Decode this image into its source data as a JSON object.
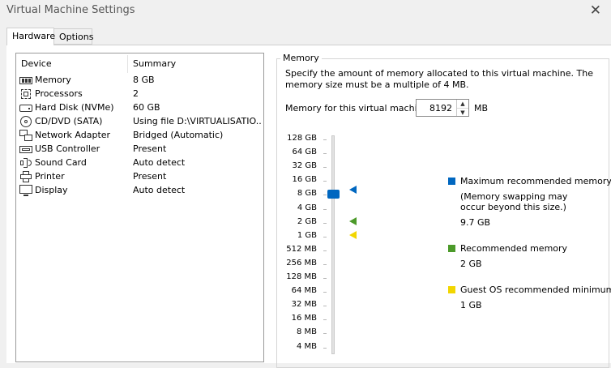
{
  "window": {
    "title": "Virtual Machine Settings",
    "close_glyph": "✕"
  },
  "tabs": [
    {
      "label": "Hardware"
    },
    {
      "label": "Options"
    }
  ],
  "device_list": {
    "headers": {
      "device": "Device",
      "summary": "Summary"
    },
    "rows": [
      {
        "device": "Memory",
        "summary": "8 GB",
        "icon": "memory-icon"
      },
      {
        "device": "Processors",
        "summary": "2",
        "icon": "processor-icon"
      },
      {
        "device": "Hard Disk (NVMe)",
        "summary": "60 GB",
        "icon": "hard-disk-icon"
      },
      {
        "device": "CD/DVD (SATA)",
        "summary": "Using file D:\\VIRTUALISATIO...",
        "icon": "cd-dvd-icon"
      },
      {
        "device": "Network Adapter",
        "summary": "Bridged (Automatic)",
        "icon": "network-adapter-icon"
      },
      {
        "device": "USB Controller",
        "summary": "Present",
        "icon": "usb-icon"
      },
      {
        "device": "Sound Card",
        "summary": "Auto detect",
        "icon": "speaker-icon"
      },
      {
        "device": "Printer",
        "summary": "Present",
        "icon": "printer-icon"
      },
      {
        "device": "Display",
        "summary": "Auto detect",
        "icon": "monitor-icon"
      }
    ]
  },
  "memory": {
    "group_title": "Memory",
    "description": "Specify the amount of memory allocated to this virtual machine. The memory size must be a multiple of 4 MB.",
    "field_label": "Memory for this virtual machine:",
    "value": "8192",
    "unit": "MB",
    "spin_up_glyph": "▲",
    "spin_down_glyph": "▼",
    "slider_value": "8 GB",
    "scale": [
      "128 GB",
      "64 GB",
      "32 GB",
      "16 GB",
      "8 GB",
      "4 GB",
      "2 GB",
      "1 GB",
      "512 MB",
      "256 MB",
      "128 MB",
      "64 MB",
      "32 MB",
      "16 MB",
      "8 MB",
      "4 MB"
    ],
    "legend": {
      "max": {
        "label": "Maximum recommended memory",
        "note_line1": "(Memory swapping may",
        "note_line2": "occur beyond this size.)",
        "value": "9.7 GB",
        "color": "#0067c0"
      },
      "recommended": {
        "label": "Recommended memory",
        "value": "2 GB",
        "color": "#4c9a2a"
      },
      "guest_min": {
        "label": "Guest OS recommended minimum",
        "value": "1 GB",
        "color": "#f2d600"
      }
    }
  }
}
